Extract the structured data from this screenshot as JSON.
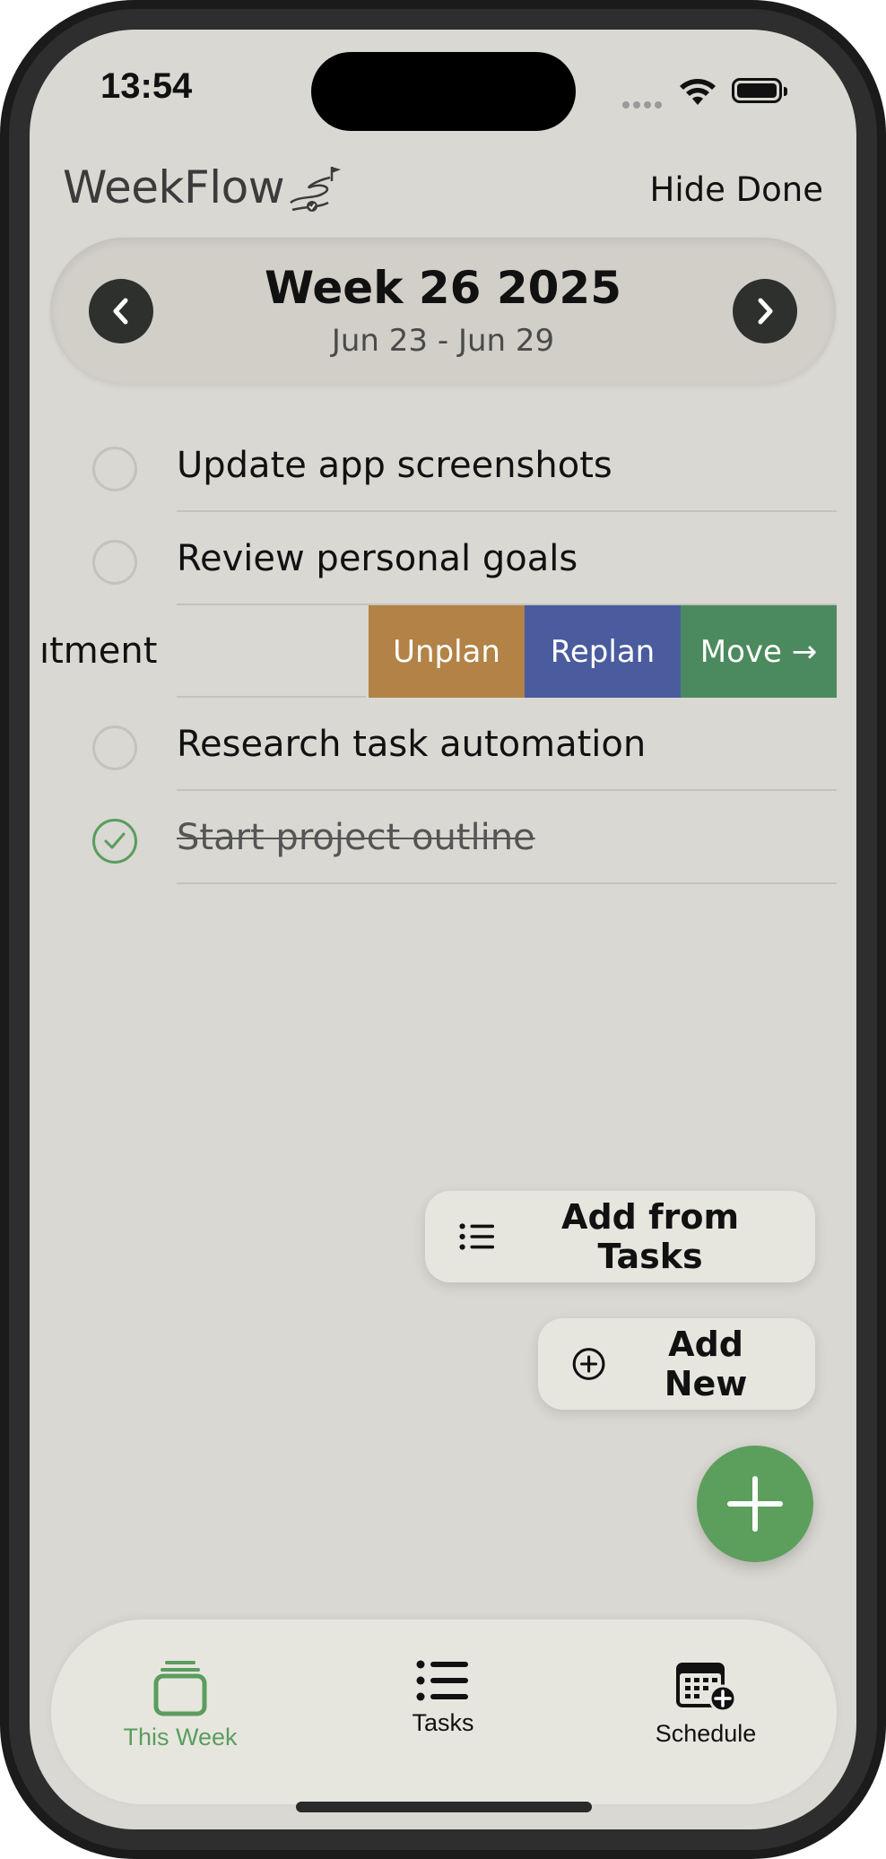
{
  "status": {
    "time": "13:54"
  },
  "header": {
    "app_title": "WeekFlow",
    "hide_done_label": "Hide Done"
  },
  "week": {
    "title": "Week 26 2025",
    "range": "Jun 23 - Jun 29"
  },
  "tasks": [
    {
      "label": "Update app screenshots",
      "done": false
    },
    {
      "label": "Review personal goals",
      "done": false
    },
    {
      "label": "Research task automation",
      "done": false
    },
    {
      "label": "Start project outline",
      "done": true
    }
  ],
  "swiped_row": {
    "visible_text": "ıtment",
    "actions": {
      "unplan": "Unplan",
      "replan": "Replan",
      "move": "Move →"
    }
  },
  "fab_menu": {
    "add_from_tasks": "Add from Tasks",
    "add_new": "Add New"
  },
  "tabs": [
    {
      "label": "This Week",
      "active": true
    },
    {
      "label": "Tasks",
      "active": false
    },
    {
      "label": "Schedule",
      "active": false
    }
  ],
  "colors": {
    "accent_green": "#5c9f5d",
    "unplan": "#b38247",
    "replan": "#4a5b9e",
    "move": "#4b8a5e",
    "background": "#d9d8d2"
  },
  "icons": {
    "prev_week": "chevron-left-icon",
    "next_week": "chevron-right-icon",
    "add_from_tasks": "list-icon",
    "add_new": "plus-circle-icon",
    "fab": "plus-icon",
    "tab_this_week": "stack-icon",
    "tab_tasks": "list-icon",
    "tab_schedule": "calendar-plus-icon"
  }
}
